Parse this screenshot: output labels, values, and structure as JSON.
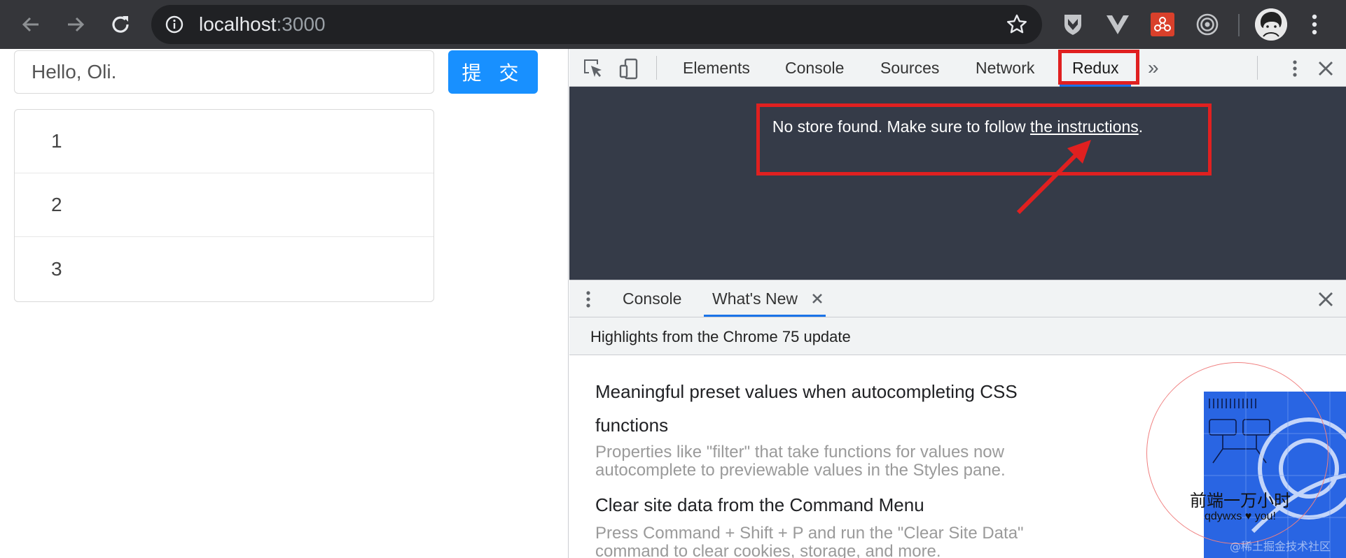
{
  "browser": {
    "url_host": "localhost",
    "url_port": ":3000",
    "icons": [
      "back-icon",
      "forward-icon",
      "reload-icon",
      "info-icon",
      "star-icon",
      "menu-icon"
    ],
    "extensions": [
      "shield-extension-icon",
      "vue-extension-icon",
      "redux-extension-icon",
      "target-extension-icon"
    ]
  },
  "page": {
    "input_value": "Hello, Oli.",
    "submit_label": "提 交",
    "list_items": [
      "1",
      "2",
      "3"
    ]
  },
  "devtools": {
    "tabs": [
      "Elements",
      "Console",
      "Sources",
      "Network",
      "Redux"
    ],
    "active_tab": "Redux",
    "more_tabs": "»",
    "redux": {
      "message_prefix": "No store found. Make sure to follow ",
      "link_text": "the instructions",
      "message_suffix": "."
    },
    "drawer": {
      "tabs": [
        "Console",
        "What's New"
      ],
      "active_tab": "What's New"
    },
    "whats_new": {
      "header": "Highlights from the Chrome 75 update",
      "items": [
        {
          "title": "Meaningful preset values when autocompleting CSS functions",
          "description": "Properties like \"filter\" that take functions for values now autocomplete to previewable values in the Styles pane."
        },
        {
          "title": "Clear site data from the Command Menu",
          "description": "Press Command + Shift + P and run the \"Clear Site Data\" command to clear cookies, storage, and more."
        }
      ]
    },
    "badge": {
      "caption": "前端一万小时",
      "subcaption": "qdywxs ♥ you!"
    }
  },
  "watermark": "@稀土掘金技术社区",
  "colors": {
    "primary_button": "#1890ff",
    "redux_panel_bg": "#353b48",
    "annotation": "#e02020",
    "tab_underline": "#1a73e8"
  }
}
